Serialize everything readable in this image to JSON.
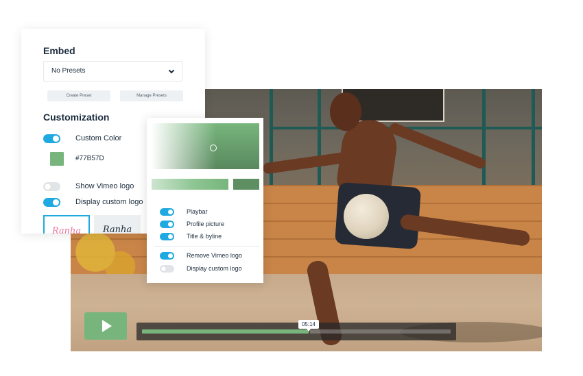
{
  "video": {
    "timestamp": "05:14",
    "progress_fraction": 0.54,
    "accent_color": "#77B57D"
  },
  "embed": {
    "title": "Embed",
    "preset_select": {
      "value": "No Presets"
    },
    "create_preset_label": "Create Preset",
    "manage_presets_label": "Manage Presets",
    "customization_title": "Customization",
    "custom_color_label": "Custom Color",
    "custom_color_on": true,
    "color_hex": "#77B57D",
    "show_vimeo_logo_label": "Show Vimeo logo",
    "show_vimeo_logo_on": false,
    "display_custom_logo_label": "Display custom logo",
    "display_custom_logo_on": true,
    "logo_options": [
      "Ranha",
      "Ranha"
    ]
  },
  "picker": {
    "options": [
      {
        "label": "Playbar",
        "on": true
      },
      {
        "label": "Profile picture",
        "on": true
      },
      {
        "label": "Title & byline",
        "on": true
      },
      {
        "label": "Remove Vimeo logo",
        "on": true
      },
      {
        "label": "Display custom logo",
        "on": false
      }
    ]
  },
  "icons": {
    "play": "play-icon",
    "dropdown": "chevron-down-icon"
  }
}
